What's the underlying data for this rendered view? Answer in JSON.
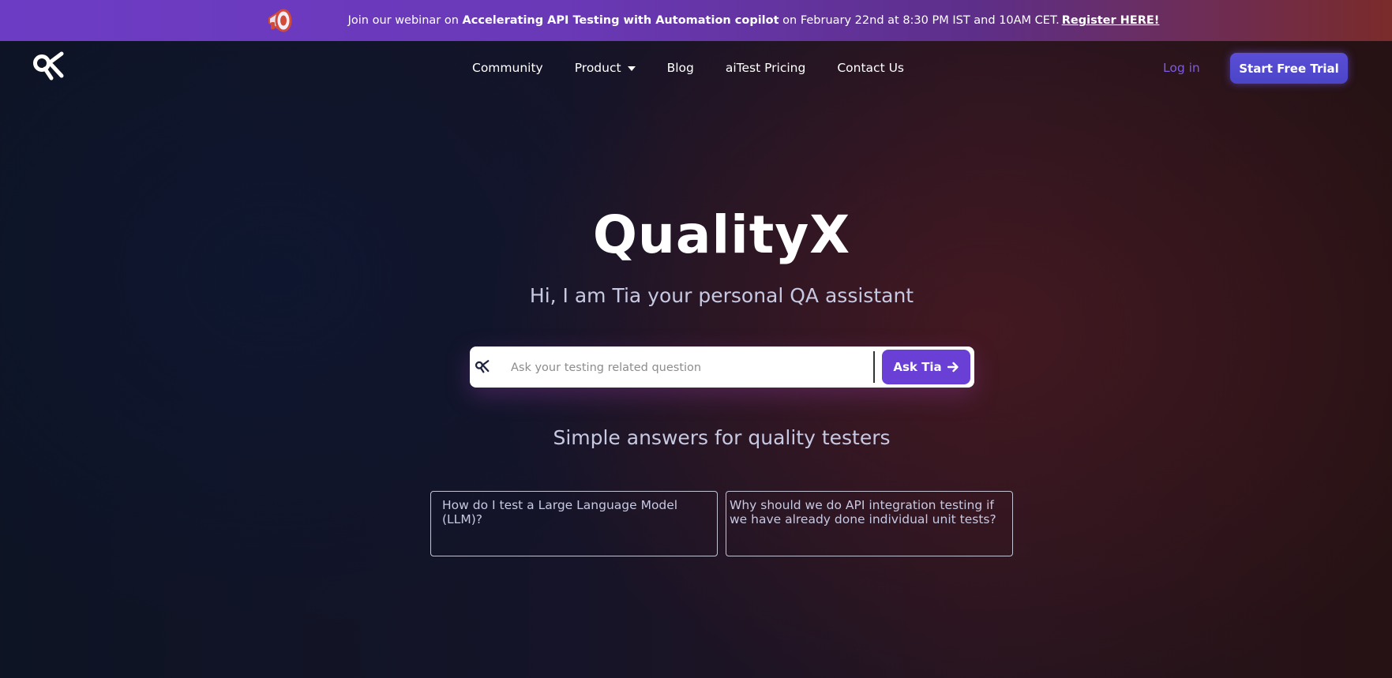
{
  "banner": {
    "prefix": "Join our webinar on ",
    "highlight": "Accelerating API Testing with Automation copilot",
    "suffix": " on February 22nd at 8:30 PM IST and 10AM CET.",
    "link_label": "Register HERE!",
    "icon": "megaphone-icon"
  },
  "nav": {
    "logo": "qualityx-logo",
    "items": [
      {
        "label": "Community"
      },
      {
        "label": "Product",
        "has_dropdown": true
      },
      {
        "label": "Blog"
      },
      {
        "label": "aiTest Pricing"
      },
      {
        "label": "Contact Us"
      }
    ],
    "login_label": "Log in",
    "trial_label": "Start Free Trial"
  },
  "hero": {
    "title": "QualityX",
    "subtitle": "Hi, I am Tia your personal QA assistant"
  },
  "search": {
    "placeholder": "Ask your testing related question",
    "value": "",
    "button_label": "Ask Tia"
  },
  "answers": {
    "title": "Simple answers for quality testers",
    "cards": [
      {
        "text": "How do I test a Large Language Model (LLM)?"
      },
      {
        "text": "Why should we do API integration testing if we have already done individual unit tests?"
      }
    ]
  },
  "colors": {
    "accent": "#6a3fd6",
    "login": "#7d5ae6",
    "trial_button": "#5a4ed6",
    "banner_start": "#6c3cc4",
    "banner_end": "#7a2b2a"
  }
}
